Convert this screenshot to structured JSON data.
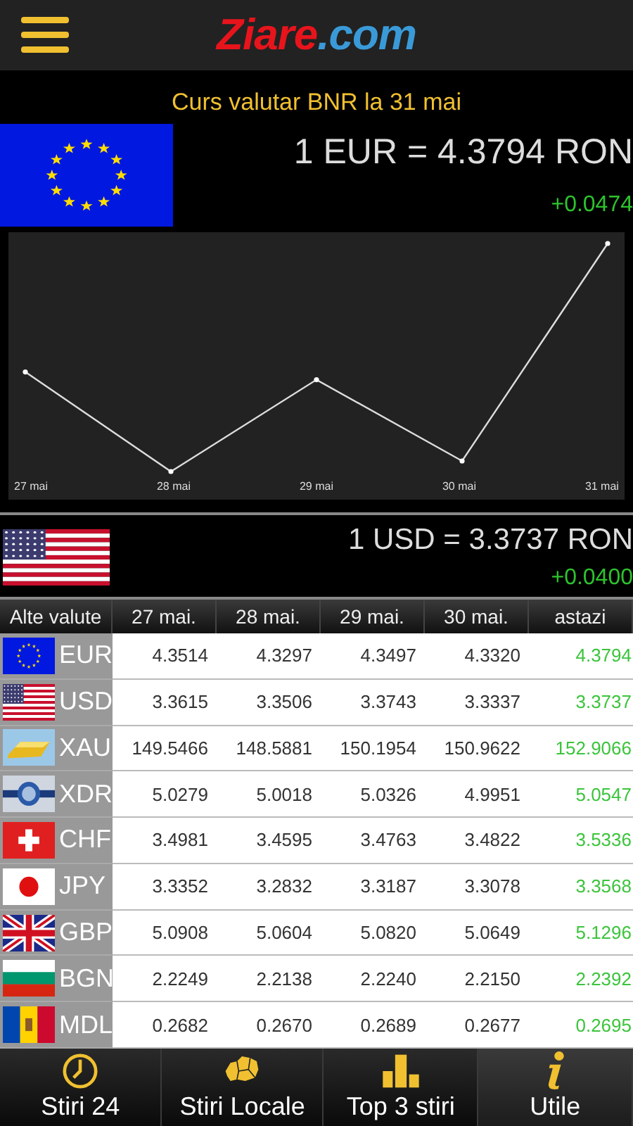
{
  "header": {
    "logo_main": "Ziare",
    "logo_suffix": ".com"
  },
  "title": "Curs valutar BNR la 31 mai",
  "main_rate": {
    "kind": "eu",
    "rate": "1 EUR = 4.3794 RON",
    "change": "+0.0474"
  },
  "chart": {
    "x_labels": [
      "27 mai",
      "28 mai",
      "29 mai",
      "30 mai",
      "31 mai"
    ]
  },
  "second_rate": {
    "kind": "us",
    "rate": "1 USD = 3.3737 RON",
    "change": "+0.0400"
  },
  "table": {
    "columns": [
      "Alte valute",
      "27 mai.",
      "28 mai.",
      "29 mai.",
      "30 mai.",
      "astazi"
    ],
    "rows": [
      {
        "kind": "eu",
        "code": "EUR",
        "values": [
          "4.3514",
          "4.3297",
          "4.3497",
          "4.3320"
        ],
        "today": "4.3794"
      },
      {
        "kind": "us",
        "code": "USD",
        "values": [
          "3.3615",
          "3.3506",
          "3.3743",
          "3.3337"
        ],
        "today": "3.3737"
      },
      {
        "kind": "gold",
        "code": "XAU",
        "values": [
          "149.5466",
          "148.5881",
          "150.1954",
          "150.9622"
        ],
        "today": "152.9066"
      },
      {
        "kind": "imf",
        "code": "XDR",
        "values": [
          "5.0279",
          "5.0018",
          "5.0326",
          "4.9951"
        ],
        "today": "5.0547"
      },
      {
        "kind": "ch",
        "code": "CHF",
        "values": [
          "3.4981",
          "3.4595",
          "3.4763",
          "3.4822"
        ],
        "today": "3.5336"
      },
      {
        "kind": "jp",
        "code": "JPY",
        "values": [
          "3.3352",
          "3.2832",
          "3.3187",
          "3.3078"
        ],
        "today": "3.3568"
      },
      {
        "kind": "gb",
        "code": "GBP",
        "values": [
          "5.0908",
          "5.0604",
          "5.0820",
          "5.0649"
        ],
        "today": "5.1296"
      },
      {
        "kind": "bg",
        "code": "BGN",
        "values": [
          "2.2249",
          "2.2138",
          "2.2240",
          "2.2150"
        ],
        "today": "2.2392"
      },
      {
        "kind": "md",
        "code": "MDL",
        "values": [
          "0.2682",
          "0.2670",
          "0.2689",
          "0.2677"
        ],
        "today": "0.2695"
      }
    ]
  },
  "nav": [
    {
      "kind": "clock",
      "label": "Stiri 24",
      "selected": false
    },
    {
      "kind": "map",
      "label": "Stiri Locale",
      "selected": false
    },
    {
      "kind": "bars",
      "label": "Top 3 stiri",
      "selected": false
    },
    {
      "kind": "info",
      "label": "Utile",
      "selected": true
    }
  ]
}
